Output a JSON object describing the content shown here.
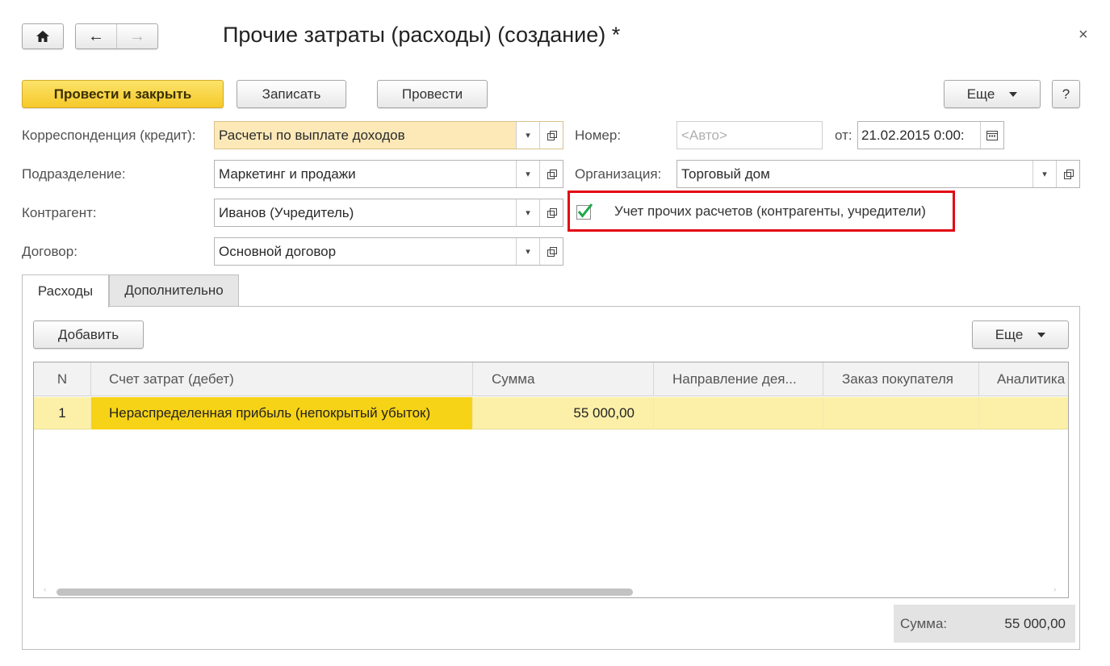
{
  "window": {
    "title": "Прочие затраты (расходы) (создание) *",
    "close_glyph": "×"
  },
  "nav": {
    "home_glyph": "⌂",
    "back_glyph": "←",
    "forward_glyph": "→"
  },
  "toolbar": {
    "post_and_close": "Провести и закрыть",
    "save": "Записать",
    "post": "Провести",
    "more": "Еще",
    "help": "?"
  },
  "form": {
    "correspondence_label": "Корреспонденция (кредит):",
    "correspondence_value": "Расчеты по выплате доходов",
    "department_label": "Подразделение:",
    "department_value": "Маркетинг и продажи",
    "counterparty_label": "Контрагент:",
    "counterparty_value": "Иванов (Учредитель)",
    "contract_label": "Договор:",
    "contract_value": "Основной договор",
    "number_label": "Номер:",
    "number_placeholder": "<Авто>",
    "date_label": "от:",
    "date_value": "21.02.2015  0:00:",
    "organization_label": "Организация:",
    "organization_value": "Торговый дом",
    "other_settlements_label": "Учет прочих расчетов (контрагенты, учредители)",
    "other_settlements_checked": true,
    "dropdown_glyph": "▾"
  },
  "tabs": [
    {
      "label": "Расходы",
      "active": true
    },
    {
      "label": "Дополнительно",
      "active": false
    }
  ],
  "expenses": {
    "add_button": "Добавить",
    "more_button": "Еще",
    "columns": [
      "N",
      "Счет затрат (дебет)",
      "Сумма",
      "Направление дея...",
      "Заказ покупателя",
      "Аналитика"
    ],
    "rows": [
      {
        "n": "1",
        "account": "Нераспределенная прибыль (непокрытый убыток)",
        "amount": "55 000,00",
        "direction": "",
        "order": "",
        "analytics": ""
      }
    ],
    "scroll_left_glyph": "‹",
    "scroll_right_glyph": "›"
  },
  "totals": {
    "label": "Сумма:",
    "value": "55 000,00"
  },
  "colors": {
    "accent_yellow": "#f7d317",
    "highlight_border": "#e30613",
    "check_green": "#1ea84a"
  }
}
